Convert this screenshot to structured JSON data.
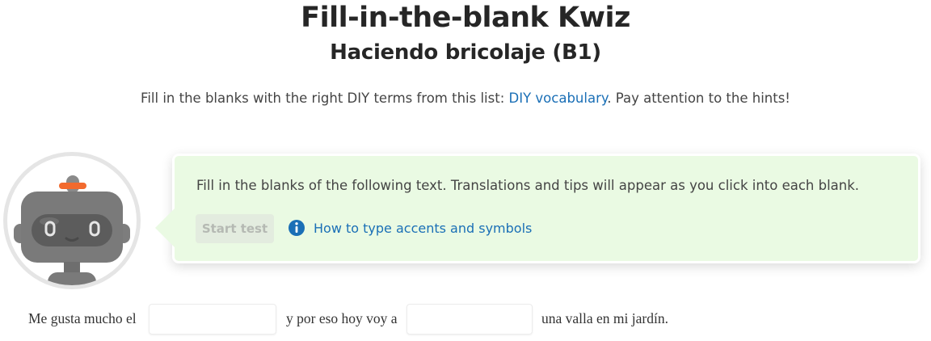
{
  "header": {
    "title": "Fill-in-the-blank Kwiz",
    "subtitle": "Haciendo bricolaje (B1)"
  },
  "intro": {
    "before": "Fill in the blanks with the right DIY terms from this list: ",
    "link": "DIY vocabulary",
    "after": ". Pay attention to the hints!"
  },
  "instructions": {
    "text": "Fill in the blanks of the following text. Translations and tips will appear as you click into each blank.",
    "start_button": "Start test",
    "help_link": "How to type accents and symbols",
    "help_icon": "info-icon"
  },
  "exercise": {
    "segment_1": "Me gusta mucho el",
    "blank_1_value": "",
    "segment_2": "y por eso hoy voy a",
    "blank_2_value": "",
    "segment_3": "una valla en mi jardín."
  },
  "colors": {
    "bubble_bg": "#eafae3",
    "link": "#1a6fb6",
    "robot_body": "#7a7a7a",
    "robot_accent": "#f26a2e"
  }
}
